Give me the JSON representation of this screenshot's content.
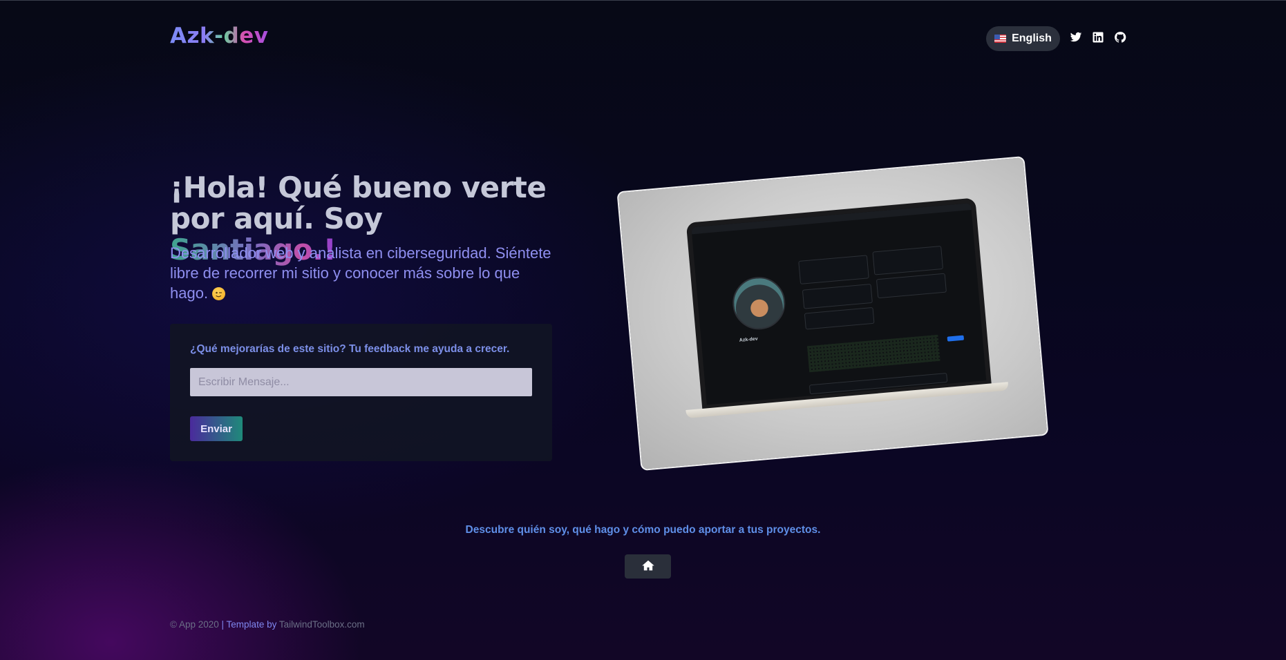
{
  "header": {
    "logo": "Azk-dev",
    "language_button": "English",
    "social": [
      "twitter-icon",
      "linkedin-icon",
      "github-icon"
    ]
  },
  "hero": {
    "title_part1": "¡Hola! Qué bueno verte por aquí. Soy ",
    "title_name": "Santiago.!",
    "subtitle": "Desarrollador web y analista en ciberseguridad. Siéntete libre de recorrer mi sitio y conocer más sobre lo que hago."
  },
  "feedback": {
    "label": "¿Qué mejorarías de este sitio? Tu feedback me ayuda a crecer.",
    "placeholder": "Escribir Mensaje...",
    "value": "",
    "submit_label": "Enviar"
  },
  "laptop_screen": {
    "profile_name": "Azk-dev"
  },
  "discover": {
    "text": "Descubre quién soy, qué hago y cómo puedo aportar a tus proyectos."
  },
  "footer": {
    "copyright": "© App 2020",
    "separator": "| Template by",
    "credit": "TailwindToolbox.com"
  },
  "colors": {
    "background": "#08071e",
    "accent_blue": "#5f8fe8",
    "accent_purple": "#8f8ff0",
    "card_bg": "#111524"
  }
}
